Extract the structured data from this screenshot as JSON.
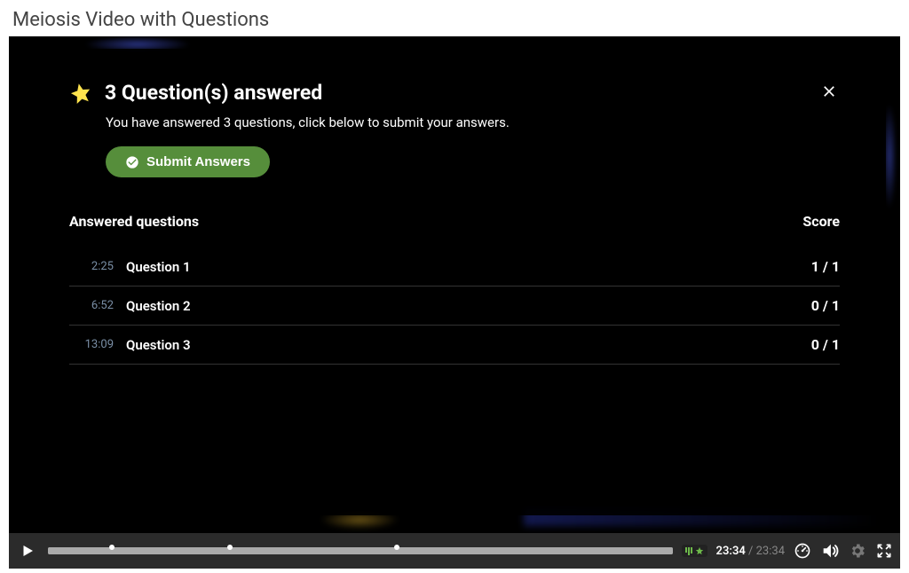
{
  "page": {
    "title": "Meiosis Video with Questions"
  },
  "modal": {
    "title": "3 Question(s) answered",
    "subtext": "You have answered 3 questions, click below to submit your answers.",
    "submit_label": "Submit Answers",
    "table": {
      "col_questions": "Answered questions",
      "col_score": "Score",
      "rows": [
        {
          "time": "2:25",
          "label": "Question 1",
          "score": "1 / 1"
        },
        {
          "time": "6:52",
          "label": "Question 2",
          "score": "0 / 1"
        },
        {
          "time": "13:09",
          "label": "Question 3",
          "score": "0 / 1"
        }
      ]
    }
  },
  "player": {
    "current_time": "23:34",
    "total_time": "23:34",
    "markers_percent": [
      10.3,
      29.1,
      55.8
    ]
  }
}
